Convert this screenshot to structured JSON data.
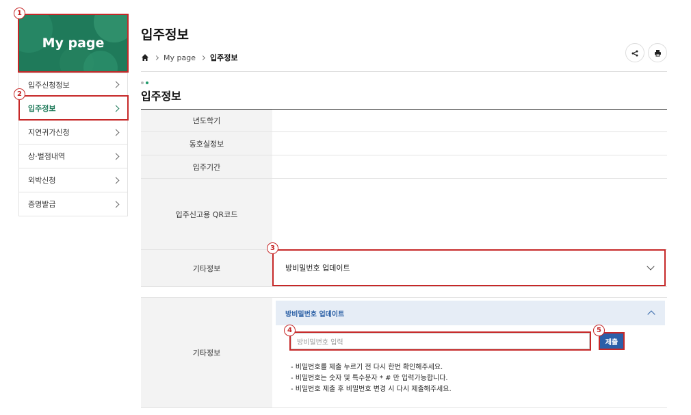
{
  "sidebar": {
    "banner_title": "My page",
    "items": [
      {
        "label": "입주신청정보"
      },
      {
        "label": "입주정보"
      },
      {
        "label": "지연귀가신청"
      },
      {
        "label": "상·벌점내역"
      },
      {
        "label": "외박신청"
      },
      {
        "label": "증명발급"
      }
    ]
  },
  "header": {
    "title": "입주정보",
    "breadcrumb": [
      "My page",
      "입주정보"
    ]
  },
  "section": {
    "title": "입주정보",
    "rows": [
      {
        "label": "년도학기"
      },
      {
        "label": "동호실정보"
      },
      {
        "label": "입주기간"
      },
      {
        "label": "입주신고용 QR코드"
      },
      {
        "label": "기타정보"
      }
    ],
    "accordion_label": "방비밀번호 업데이트"
  },
  "expanded": {
    "label": "기타정보",
    "accordion_label": "방비밀번호 업데이트",
    "input_placeholder": "방비밀번호 입력",
    "submit_label": "제출",
    "notes": [
      "- 비밀번호를 제출 누르기 전 다시 한번 확인해주세요.",
      "- 비밀번호는 숫자 및 특수문자 * # 만 입력가능합니다.",
      "- 비밀번호 제출 후 비밀번호 변경 시 다시 제출해주세요."
    ]
  },
  "markers": [
    "1",
    "2",
    "3",
    "4",
    "5"
  ],
  "colors": {
    "brand": "#1f7a5a",
    "accent_blue": "#2b5fa8",
    "marker_red": "#c62828"
  }
}
